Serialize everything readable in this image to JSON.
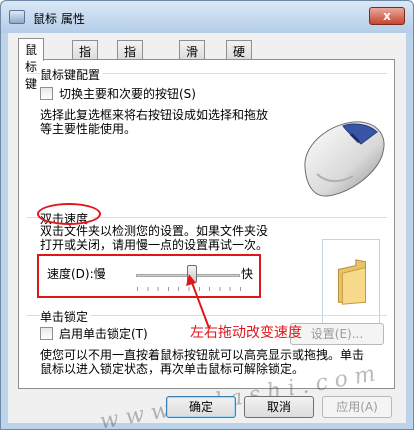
{
  "window": {
    "title": "鼠标 属性",
    "close_label": "x"
  },
  "tabs": [
    {
      "label": "鼠标键",
      "active": true
    },
    {
      "label": "指针",
      "active": false
    },
    {
      "label": "指针选项",
      "active": false
    },
    {
      "label": "滑轮",
      "active": false
    },
    {
      "label": "硬件",
      "active": false
    }
  ],
  "button_config": {
    "title": "鼠标键配置",
    "swap_checkbox_label": "切换主要和次要的按钮(S)",
    "swap_checked": false,
    "description_line1": "选择此复选框来将右按钮设成如选择和拖放",
    "description_line2": "等主要性能使用。"
  },
  "double_click": {
    "title": "双击速度",
    "description_line1": "双击文件夹以检测您的设置。如果文件夹没",
    "description_line2": "打开或关闭，请用慢一点的设置再试一次。",
    "speed_label": "速度(D):慢",
    "fast_label": "快",
    "speed_value_fraction": 0.5
  },
  "click_lock": {
    "title": "单击锁定",
    "checkbox_label": "启用单击锁定(T)",
    "checked": false,
    "settings_button": "设置(E)...",
    "description_line1": "使您可以不用一直按着鼠标按钮就可以高亮显示或拖拽。单击",
    "description_line2": "鼠标以进入锁定状态，再次单击鼠标可解除锁定。"
  },
  "annotation": {
    "text": "左右拖动改变速度",
    "color": "#e0161a"
  },
  "watermark": "www.udashi.com",
  "footer": {
    "ok": "确定",
    "cancel": "取消",
    "apply": "应用(A)"
  }
}
